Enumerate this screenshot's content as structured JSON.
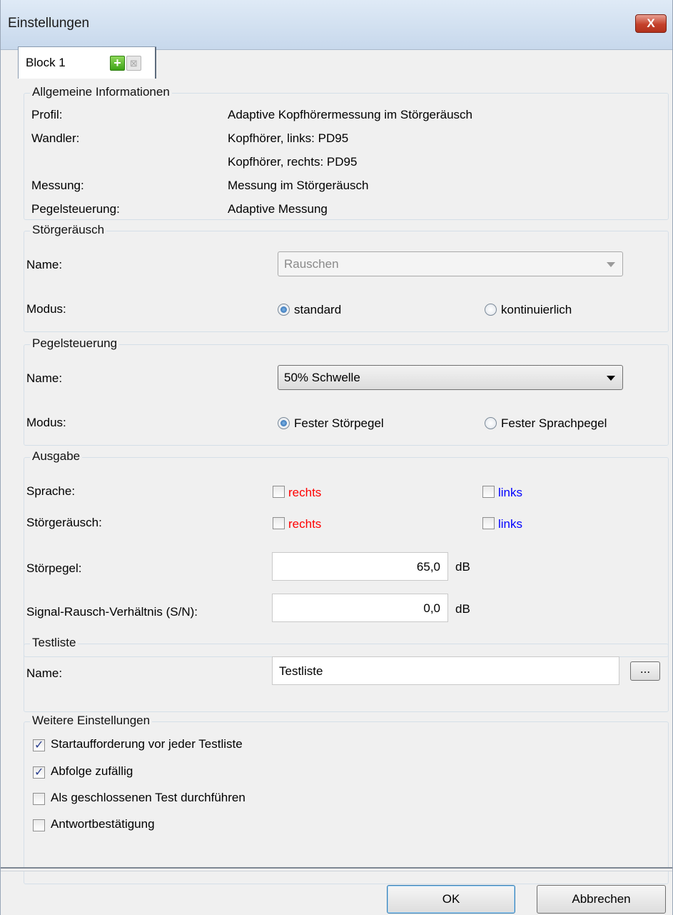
{
  "window": {
    "title": "Einstellungen",
    "close_label": "X"
  },
  "tab": {
    "label": "Block 1",
    "add_icon": "+",
    "remove_icon": "⊠"
  },
  "general": {
    "title": "Allgemeine Informationen",
    "rows": [
      {
        "label": "Profil:",
        "value": "Adaptive Kopfhörermessung im Störgeräusch"
      },
      {
        "label": "Wandler:",
        "value": "Kopfhörer, links: PD95"
      },
      {
        "label": "",
        "value": "Kopfhörer, rechts: PD95"
      },
      {
        "label": "Messung:",
        "value": "Messung im Störgeräusch"
      },
      {
        "label": "Pegelsteuerung:",
        "value": "Adaptive Messung"
      }
    ]
  },
  "noise": {
    "title": "Störgeräusch",
    "name_label": "Name:",
    "name_value": "Rauschen",
    "mode_label": "Modus:",
    "mode_options": [
      "standard",
      "kontinuierlich"
    ],
    "mode_selected": "standard"
  },
  "level": {
    "title": "Pegelsteuerung",
    "name_label": "Name:",
    "name_value": "50% Schwelle",
    "mode_label": "Modus:",
    "mode_options": [
      "Fester Störpegel",
      "Fester Sprachpegel"
    ],
    "mode_selected": "Fester Störpegel"
  },
  "output": {
    "title": "Ausgabe",
    "speech_label": "Sprache:",
    "noise_label": "Störgeräusch:",
    "right_label": "rechts",
    "left_label": "links",
    "right_color": "#ff0000",
    "left_color": "#0000ff",
    "speech_right_checked": false,
    "speech_left_checked": false,
    "noise_right_checked": false,
    "noise_left_checked": false,
    "noise_level_label": "Störpegel:",
    "noise_level_value": "65,0",
    "snr_label": "Signal-Rausch-Verhältnis (S/N):",
    "snr_value": "0,0",
    "unit": "dB"
  },
  "testlist": {
    "title": "Testliste",
    "name_label": "Name:",
    "name_value": "Testliste",
    "browse_label": "..."
  },
  "more": {
    "title": "Weitere Einstellungen",
    "options": [
      {
        "label": "Startaufforderung vor jeder Testliste",
        "checked": true
      },
      {
        "label": "Abfolge zufällig",
        "checked": true
      },
      {
        "label": "Als geschlossenen Test durchführen",
        "checked": false
      },
      {
        "label": "Antwortbestätigung",
        "checked": false
      }
    ]
  },
  "buttons": {
    "ok": "OK",
    "cancel": "Abbrechen"
  }
}
